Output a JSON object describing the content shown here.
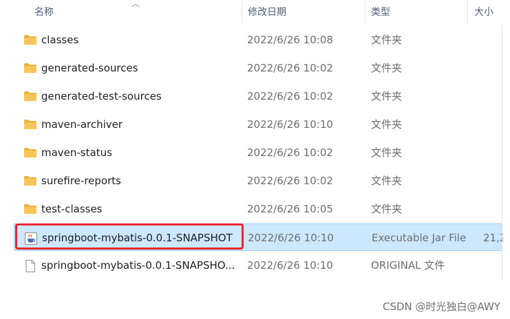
{
  "columns": {
    "name": "名称",
    "modified": "修改日期",
    "type": "类型",
    "size": "大小"
  },
  "files": [
    {
      "name": "classes",
      "date": "2022/6/26 10:08",
      "type": "文件夹",
      "size": "",
      "icon": "folder-icon"
    },
    {
      "name": "generated-sources",
      "date": "2022/6/26 10:02",
      "type": "文件夹",
      "size": "",
      "icon": "folder-icon"
    },
    {
      "name": "generated-test-sources",
      "date": "2022/6/26 10:02",
      "type": "文件夹",
      "size": "",
      "icon": "folder-icon"
    },
    {
      "name": "maven-archiver",
      "date": "2022/6/26 10:10",
      "type": "文件夹",
      "size": "",
      "icon": "folder-icon"
    },
    {
      "name": "maven-status",
      "date": "2022/6/26 10:02",
      "type": "文件夹",
      "size": "",
      "icon": "folder-icon"
    },
    {
      "name": "surefire-reports",
      "date": "2022/6/26 10:02",
      "type": "文件夹",
      "size": "",
      "icon": "folder-icon"
    },
    {
      "name": "test-classes",
      "date": "2022/6/26 10:05",
      "type": "文件夹",
      "size": "",
      "icon": "folder-icon"
    },
    {
      "name": "springboot-mybatis-0.0.1-SNAPSHOT",
      "date": "2022/6/26 10:10",
      "type": "Executable Jar File",
      "size": "21,2",
      "icon": "jar-file-icon",
      "selected": true
    },
    {
      "name": "springboot-mybatis-0.0.1-SNAPSHO...",
      "date": "2022/6/26 10:10",
      "type": "ORIGINAL 文件",
      "size": "",
      "icon": "blank-file-icon"
    }
  ],
  "watermark": "CSDN @时光独白@AWY",
  "colors": {
    "selected_bg": "#cce8ff",
    "highlight_border": "#e8262d",
    "folder": "#f8c55a"
  }
}
